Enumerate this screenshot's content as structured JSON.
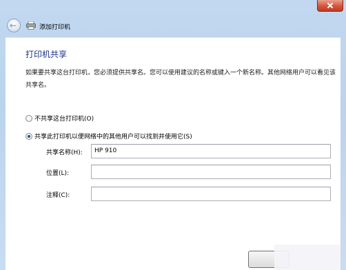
{
  "window": {
    "title": "添加打印机",
    "accent": "#1e3287"
  },
  "icons": {
    "back": "back-arrow-icon",
    "printer": "printer-icon",
    "close": "close-icon"
  },
  "page": {
    "heading": "打印机共享",
    "description": "如果要共享这台打印机，您必须提供共享名。您可以使用建议的名称或键入一个新名称。其他网络用户可以看见该共享名。"
  },
  "options": {
    "no_share": {
      "label": "不共享这台打印机(O)",
      "selected": false
    },
    "share": {
      "label": "共享此打印机以便网络中的其他用户可以找到并使用它(S)",
      "selected": true
    }
  },
  "fields": {
    "share_name": {
      "label": "共享名称(H):",
      "value": "HP 910"
    },
    "location": {
      "label": "位置(L):",
      "value": ""
    },
    "comment": {
      "label": "注释(C):",
      "value": ""
    }
  }
}
